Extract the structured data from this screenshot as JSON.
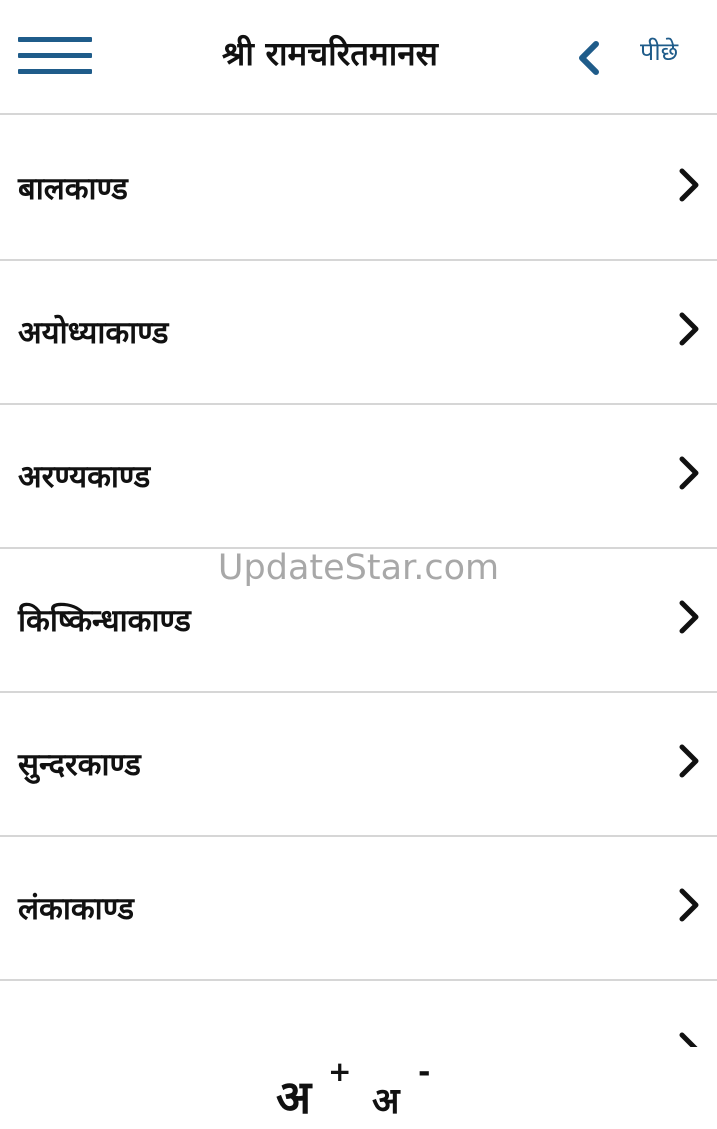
{
  "header": {
    "title": "श्री रामचरितमानस",
    "back_label": "पीछे",
    "menu_icon": "hamburger-menu-icon",
    "back_icon": "chevron-left-icon"
  },
  "list": {
    "items": [
      {
        "label": "बालकाण्ड",
        "icon": "chevron-right-icon"
      },
      {
        "label": "अयोध्याकाण्ड",
        "icon": "chevron-right-icon"
      },
      {
        "label": "अरण्यकाण्ड",
        "icon": "chevron-right-icon"
      },
      {
        "label": "किष्किन्धाकाण्ड",
        "icon": "chevron-right-icon"
      },
      {
        "label": "सुन्दरकाण्ड",
        "icon": "chevron-right-icon"
      },
      {
        "label": "लंकाकाण्ड",
        "icon": "chevron-right-icon"
      }
    ]
  },
  "watermark": "UpdateStar.com",
  "font_controls": {
    "increase_glyph": "अ",
    "increase_sign": "+",
    "decrease_glyph": "अ",
    "decrease_sign": "-"
  },
  "colors": {
    "accent": "#1f5c8a",
    "text": "#111111",
    "divider": "#d6d6d6",
    "background": "#ffffff"
  }
}
